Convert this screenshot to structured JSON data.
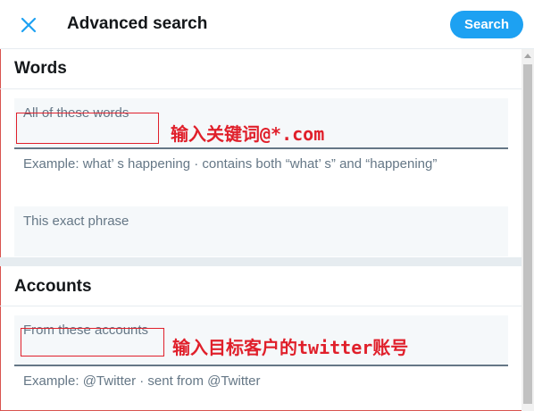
{
  "header": {
    "title": "Advanced search",
    "search_label": "Search",
    "close_icon": "close-icon"
  },
  "sections": {
    "words": {
      "title": "Words",
      "all_words_label": "All of these words",
      "all_words_hint": "Example: what’ s happening · contains both “what’ s” and “happening”",
      "exact_phrase_label": "This exact phrase"
    },
    "accounts": {
      "title": "Accounts",
      "from_label": "From these accounts",
      "from_hint": "Example: @Twitter · sent from @Twitter"
    }
  },
  "annotations": {
    "keyword_note": "输入关键词@*.com",
    "account_note": "输入目标客户的twitter账号"
  },
  "colors": {
    "accent": "#1da1f2",
    "annotation": "#e0202b",
    "field_bg": "#f5f8fa",
    "muted_text": "#657786"
  }
}
